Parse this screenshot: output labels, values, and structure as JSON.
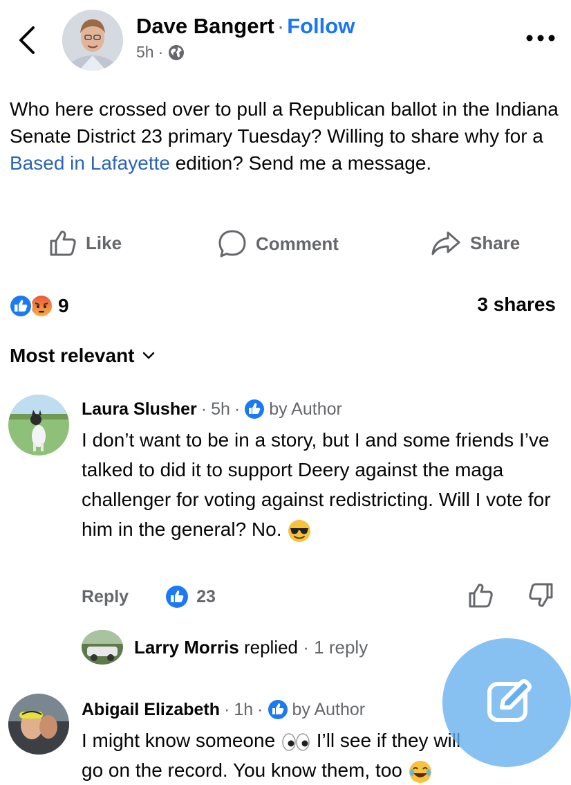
{
  "post": {
    "author": "Dave Bangert",
    "separator": "·",
    "follow_label": "Follow",
    "time": "5h",
    "meta_separator": "·",
    "audience_icon": "globe-icon",
    "text_before_link": "Who here crossed over to pull a Republican ballot in the Indiana Senate District 23 primary Tuesday? Willing to share why for a ",
    "link_text": "Based in Lafayette",
    "text_after_link": " edition? Send me a message."
  },
  "actions": {
    "like": "Like",
    "comment": "Comment",
    "share": "Share"
  },
  "stats": {
    "reaction_icons": [
      "like-reaction-icon",
      "angry-reaction-icon"
    ],
    "reaction_count": "9",
    "shares": "3 shares"
  },
  "sort": {
    "label": "Most relevant"
  },
  "comments": [
    {
      "name": "Laura Slusher",
      "time": "5h",
      "sep": "·",
      "badge": "by Author",
      "text": "I don’t want to be in a story, but I and some friends I’ve talked to did it to support Deery against the maga challenger for voting against redistricting. Will I vote for him in the general? No.",
      "emoji": "sunglasses-emoji",
      "reply_label": "Reply",
      "like_count": "23"
    },
    {
      "name": "Abigail Elizabeth",
      "time": "1h",
      "sep": "·",
      "badge": "by Author",
      "text_line1_before": "I might know someone",
      "text_line1_after": "I’ll see if they will",
      "text_line2": "go on the record. You know them, too",
      "emoji1": "eyes-emoji",
      "emoji2": "laughing-emoji"
    }
  ],
  "reply_thread": {
    "name": "Larry Morris",
    "action": "replied",
    "sep": "·",
    "count": "1 reply"
  },
  "colors": {
    "accent": "#1877f2",
    "muted": "#65676b",
    "link": "#2a64b6",
    "fab": "#64afee"
  }
}
